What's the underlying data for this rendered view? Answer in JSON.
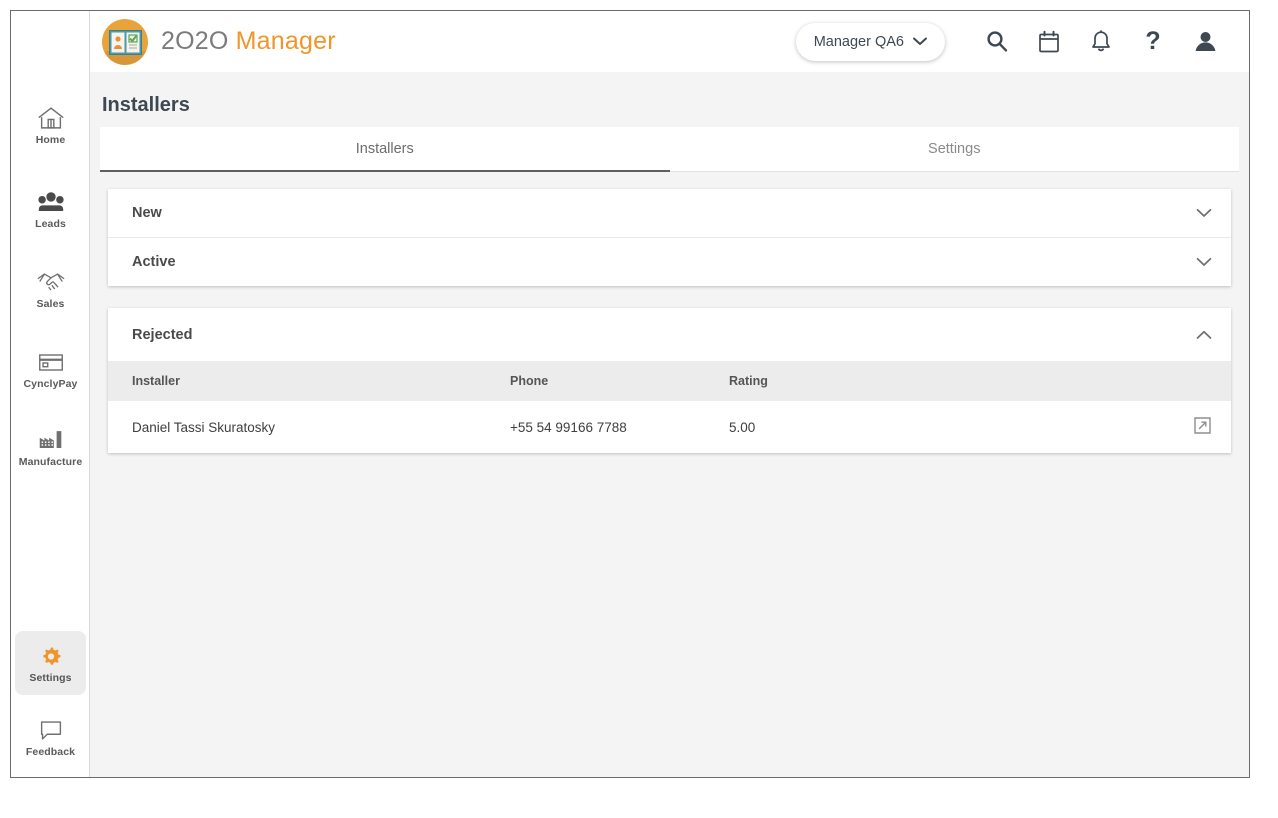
{
  "brand": {
    "text_primary": "2O2O",
    "text_secondary": "Manager",
    "logo_icon": "installer-badge-icon",
    "accent_color": "#f0952a",
    "mark_color": "#e8a33d"
  },
  "header": {
    "user_pill_label": "Manager QA6",
    "chevron_icon": "chevron-down-icon",
    "actions": [
      {
        "name": "search-icon",
        "title": "Search"
      },
      {
        "name": "calendar-icon",
        "title": "Calendar"
      },
      {
        "name": "bell-icon",
        "title": "Notifications"
      },
      {
        "name": "help-icon",
        "title": "Help"
      },
      {
        "name": "account-icon",
        "title": "Account"
      }
    ]
  },
  "sidebar": {
    "items": [
      {
        "label": "Home",
        "icon": "home-icon",
        "active": false
      },
      {
        "label": "Leads",
        "icon": "people-icon",
        "active": false
      },
      {
        "label": "Sales",
        "icon": "handshake-icon",
        "active": false
      },
      {
        "label": "CynclyPay",
        "icon": "credit-card-icon",
        "active": false
      },
      {
        "label": "Manufacture",
        "icon": "factory-icon",
        "active": false
      },
      {
        "label": "Settings",
        "icon": "gear-icon",
        "active": true
      },
      {
        "label": "Feedback",
        "icon": "chat-bubble-icon",
        "active": false
      }
    ],
    "active_icon_color": "#f0952a"
  },
  "page": {
    "title": "Installers"
  },
  "tabs": [
    {
      "label": "Installers",
      "active": true
    },
    {
      "label": "Settings",
      "active": false
    }
  ],
  "accordions": [
    {
      "title": "New",
      "expanded": false,
      "chevron": "chevron-down-icon"
    },
    {
      "title": "Active",
      "expanded": false,
      "chevron": "chevron-down-icon"
    },
    {
      "title": "Rejected",
      "expanded": true,
      "chevron": "chevron-up-icon"
    }
  ],
  "table": {
    "columns": [
      "Installer",
      "Phone",
      "Rating"
    ],
    "rows": [
      {
        "installer": "Daniel Tassi Skuratosky",
        "phone": "+55 54 99166 7788",
        "rating": "5.00",
        "action_icon": "external-link-icon"
      }
    ]
  }
}
